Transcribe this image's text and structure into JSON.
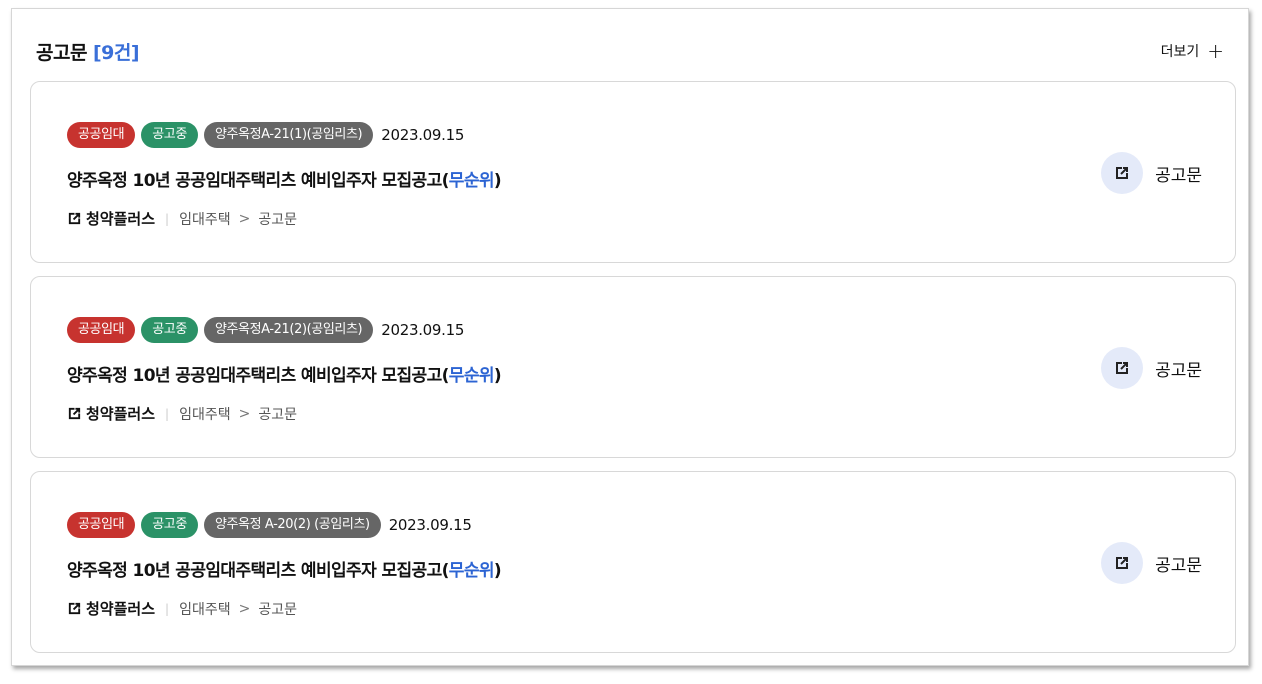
{
  "header": {
    "title": "공고문",
    "count": "[9건]",
    "more_label": "더보기",
    "more_icon": "plus-icon"
  },
  "colors": {
    "accent": "#3a6fd8",
    "badge_red": "#c7332f",
    "badge_green": "#2b9267",
    "badge_gray": "#666666"
  },
  "cards": [
    {
      "badge_type": "공공임대",
      "badge_status": "공고중",
      "badge_complex": "양주옥정A-21(1)(공임리츠)",
      "date": "2023.09.15",
      "title_main": "양주옥정 10년 공공임대주택리츠 예비입주자 모집공고(",
      "title_highlight": "무순위",
      "title_end": ")",
      "site_label": "청약플러스",
      "crumb_1": "임대주택",
      "crumb_2": "공고문",
      "doc_label": "공고문"
    },
    {
      "badge_type": "공공임대",
      "badge_status": "공고중",
      "badge_complex": "양주옥정A-21(2)(공임리츠)",
      "date": "2023.09.15",
      "title_main": "양주옥정 10년 공공임대주택리츠 예비입주자 모집공고(",
      "title_highlight": "무순위",
      "title_end": ")",
      "site_label": "청약플러스",
      "crumb_1": "임대주택",
      "crumb_2": "공고문",
      "doc_label": "공고문"
    },
    {
      "badge_type": "공공임대",
      "badge_status": "공고중",
      "badge_complex": "양주옥정 A-20(2) (공임리츠)",
      "date": "2023.09.15",
      "title_main": "양주옥정 10년 공공임대주택리츠 예비입주자 모집공고(",
      "title_highlight": "무순위",
      "title_end": ")",
      "site_label": "청약플러스",
      "crumb_1": "임대주택",
      "crumb_2": "공고문",
      "doc_label": "공고문"
    }
  ]
}
